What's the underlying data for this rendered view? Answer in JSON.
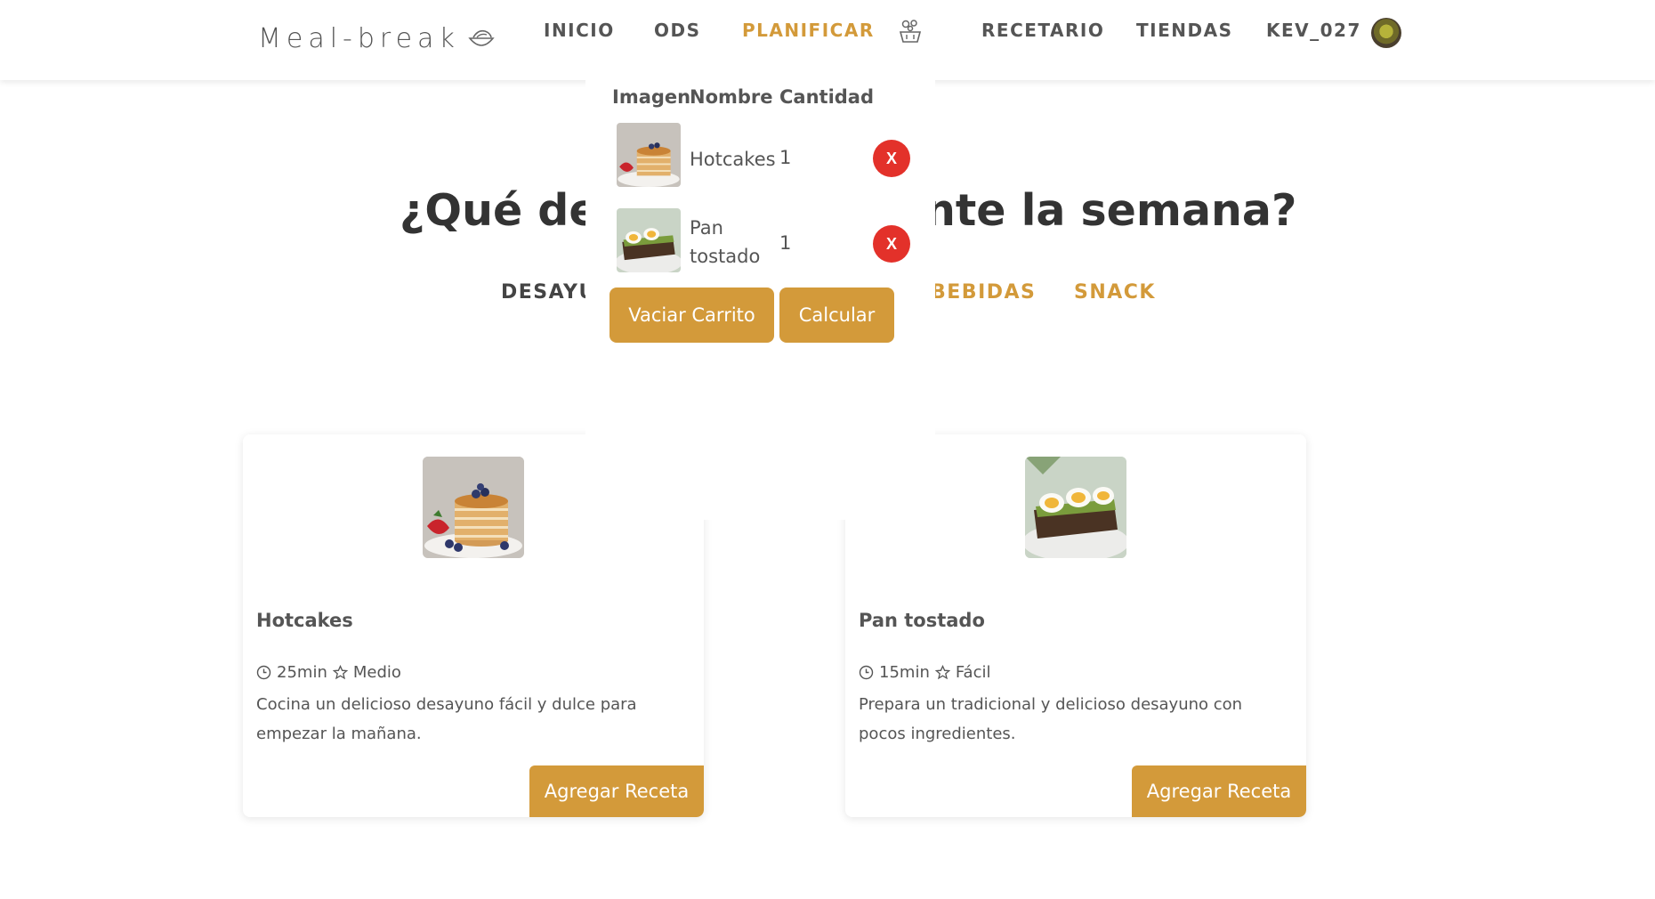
{
  "brand": {
    "name": "Meal-break",
    "icon": "bowl-icon"
  },
  "nav": {
    "items": [
      "INICIO",
      "ODS",
      "PLANIFICAR",
      "RECETARIO",
      "TIENDAS"
    ],
    "active": "PLANIFICAR",
    "cart_icon": "cart-basket-icon",
    "username": "KEV_027"
  },
  "heading": {
    "left": "¿Qué des",
    "right": "nte la semana?"
  },
  "tabs": {
    "left": "DESAYU",
    "drinks": "BEBIDAS",
    "snack": "SNACK"
  },
  "cart": {
    "headers": {
      "image": "Imagen",
      "name": "Nombre",
      "quantity": "Cantidad"
    },
    "items": [
      {
        "name": "Hotcakes",
        "quantity": "1",
        "remove_label": "X"
      },
      {
        "name": "Pan tostado",
        "quantity": "1",
        "remove_label": "X"
      }
    ],
    "empty_button": "Vaciar Carrito",
    "calculate_button": "Calcular"
  },
  "recipes": [
    {
      "title": "Hotcakes",
      "time": "25min",
      "difficulty": "Medio",
      "description": "Cocina un delicioso desayuno fácil y dulce para empezar la mañana.",
      "button": "Agregar Receta"
    },
    {
      "title": "Pan tostado",
      "time": "15min",
      "difficulty": "Fácil",
      "description": "Prepara un tradicional y delicioso desayuno con pocos ingredientes.",
      "button": "Agregar Receta"
    }
  ],
  "colors": {
    "accent": "#d39a3a",
    "remove": "#e3312a",
    "text": "#555555"
  }
}
